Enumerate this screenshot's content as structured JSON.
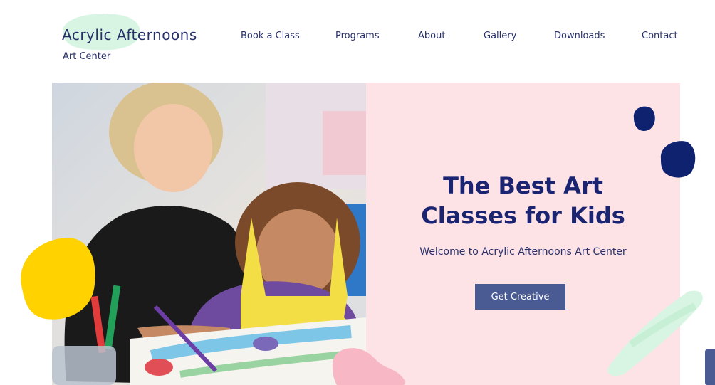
{
  "brand": {
    "title": "Acrylic Afternoons",
    "subtitle": "Art Center"
  },
  "nav": {
    "items": [
      {
        "label": "Book a Class"
      },
      {
        "label": "Programs"
      },
      {
        "label": "About"
      },
      {
        "label": "Gallery"
      },
      {
        "label": "Downloads"
      },
      {
        "label": "Contact"
      }
    ]
  },
  "hero": {
    "title_line1": "The Best Art",
    "title_line2": "Classes for Kids",
    "subtitle": "Welcome to Acrylic Afternoons Art Center",
    "cta_label": "Get Creative"
  },
  "colors": {
    "accent": "#4a5b94",
    "navy": "#1b2470",
    "panel_pink": "#fde2e6",
    "mint": "#d8f5e3",
    "yellow": "#ffd200",
    "blob_navy": "#0f2270"
  }
}
